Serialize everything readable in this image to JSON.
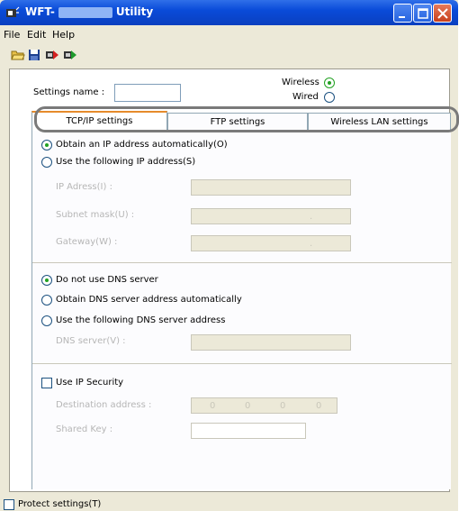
{
  "window": {
    "title_left": "WFT-",
    "title_right": "Utility"
  },
  "menu": [
    "File",
    "Edit",
    "Help"
  ],
  "toolbar_icons": [
    "open-folder-icon",
    "save-icon",
    "send-red-icon",
    "send-green-icon"
  ],
  "settings_name_label": "Settings name :",
  "connection": {
    "wireless_label": "Wireless",
    "wired_label": "Wired",
    "selected": "Wireless"
  },
  "tabs": [
    "TCP/IP settings",
    "FTP settings",
    "Wireless LAN settings"
  ],
  "ip_section": {
    "auto_label": "Obtain an IP address automatically(O)",
    "manual_label": "Use the following IP address(S)",
    "selected": "auto",
    "ip_label": "IP Adress(I) :",
    "subnet_label": "Subnet mask(U) :",
    "gateway_label": "Gateway(W) :",
    "subnet_dot": ".",
    "gateway_dot": "."
  },
  "dns_section": {
    "none_label": "Do not use DNS server",
    "auto_label": "Obtain DNS server address automatically",
    "manual_label": "Use the following DNS server address",
    "selected": "none",
    "server_label": "DNS server(V) :"
  },
  "security_section": {
    "use_label": "Use IP Security",
    "checked": false,
    "destination_label": "Destination address :",
    "destination_values": [
      "0",
      "0",
      "0",
      "0"
    ],
    "shared_key_label": "Shared Key :"
  },
  "protect_label": "Protect settings(T)"
}
